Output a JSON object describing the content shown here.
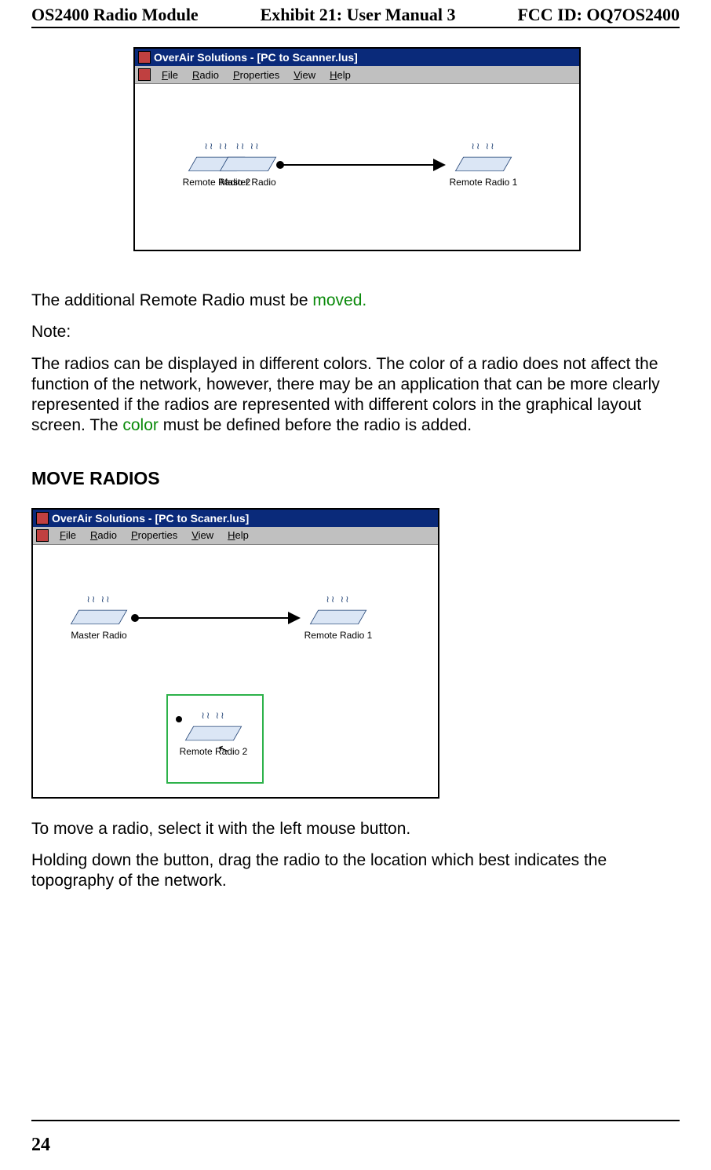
{
  "header": {
    "left": "OS2400 Radio Module",
    "center": "Exhibit 21: User Manual 3",
    "right": "FCC ID: OQ7OS2400"
  },
  "app_title_1": "OverAir Solutions - [PC to Scanner.lus]",
  "app_title_2": "OverAir Solutions - [PC to Scaner.lus]",
  "menu": {
    "file": "File",
    "radio": "Radio",
    "properties": "Properties",
    "view": "View",
    "help": "Help"
  },
  "radios": {
    "master": "Master Radio",
    "remote1": "Remote Radio 1",
    "remote2": "Remote Radio 2"
  },
  "para1_a": "The additional Remote Radio must be ",
  "para1_link": "moved.",
  "note_label": "Note:",
  "para2_a": "The radios can be displayed in different colors.  The color of a radio does not affect the function of the network, however, there may be an application that can be more clearly represented if the radios are represented with different colors in the graphical layout screen.  The ",
  "para2_link": "color",
  "para2_b": " must be defined before the radio is added.",
  "section": "MOVE RADIOS",
  "para3": "To move a radio, select it with the left mouse button.",
  "para4": "Holding down the button, drag the radio to the location which best indicates the topography of the network.",
  "page_number": "24"
}
